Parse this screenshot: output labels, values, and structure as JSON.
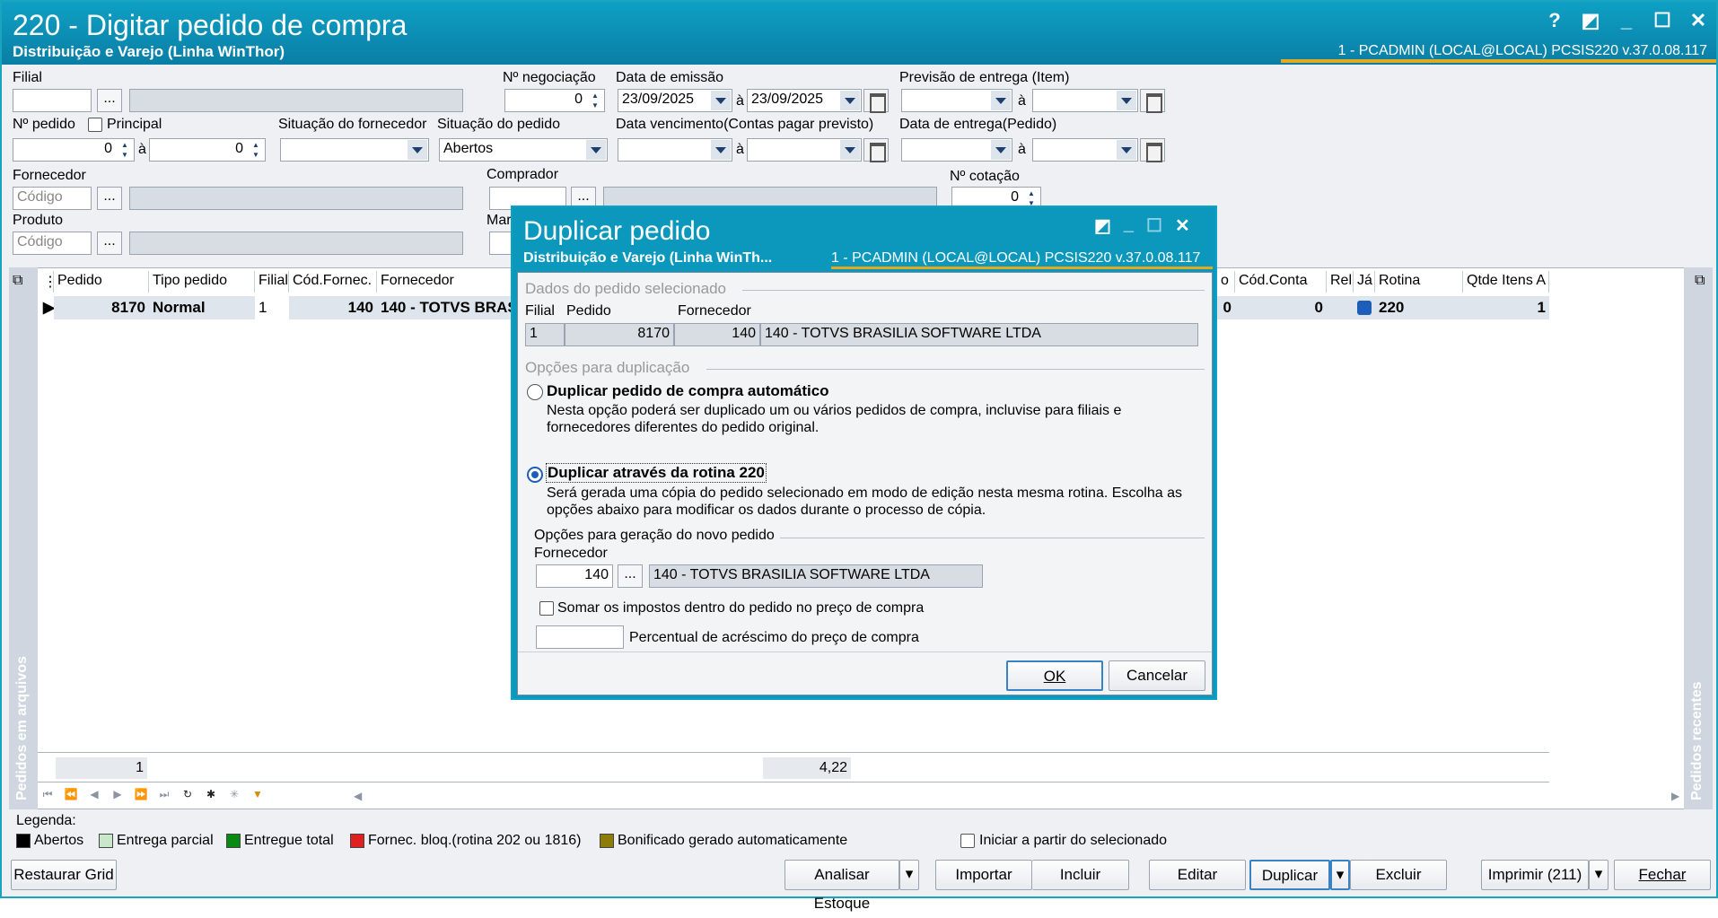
{
  "window": {
    "title": "220 - Digitar pedido de compra",
    "subtitle": "Distribuição e Varejo (Linha WinThor)",
    "status": "1 - PCADMIN (LOCAL@LOCAL)   PCSIS220  v.37.0.08.117",
    "buttons": [
      "?",
      "◩",
      "_",
      "☐",
      "✕"
    ]
  },
  "filters": {
    "filial_label": "Filial",
    "dots": "...",
    "negociacao_label": "Nº negociação",
    "negociacao_value": "0",
    "emissao_label": "Data de emissão",
    "emissao_from": "23/09/2025",
    "emissao_to": "23/09/2025",
    "a": "à",
    "previsao_label": "Previsão  de entrega (Item)",
    "pedido_label": "Nº pedido",
    "principal_label": "Principal",
    "pedido_from": "0",
    "pedido_to": "0",
    "sit_fornec_label": "Situação do fornecedor",
    "sit_pedido_label": "Situação do pedido",
    "sit_pedido_value": "Abertos",
    "vencimento_label": "Data vencimento(Contas pagar previsto)",
    "entrega_label": "Data de entrega(Pedido)",
    "fornecedor_label": "Fornecedor",
    "codigo_placeholder": "Código",
    "comprador_label": "Comprador",
    "cotacao_label": "Nº cotação",
    "cotacao_value": "0",
    "produto_label": "Produto",
    "mar_label": "Mar"
  },
  "grid": {
    "headers_left": [
      "Pedido",
      "Tipo pedido",
      "Filial",
      "Cód.Fornec.",
      "Fornecedor"
    ],
    "headers_right": [
      "o",
      "Cód.Conta",
      "Rel",
      "Já",
      "Rotina",
      "Qtde Itens A"
    ],
    "row": {
      "pedido": "8170",
      "tipo": "Normal",
      "filial": "1",
      "cod_fornec": "140",
      "fornecedor": "140 - TOTVS BRASI",
      "o": "0",
      "cod_conta": "0",
      "rotina": "220",
      "qtde": "1"
    },
    "footer_count": "1",
    "footer_total": "4,22",
    "side_left": "Pedidos em arquivos",
    "side_right": "Pedidos recentes"
  },
  "legend": {
    "label": "Legenda:",
    "items": [
      {
        "text": "Abertos",
        "color": "#000000"
      },
      {
        "text": "Entrega parcial",
        "color": "#c9e8c9"
      },
      {
        "text": "Entregue total",
        "color": "#0a8a12"
      },
      {
        "text": "Fornec. bloq.(rotina 202 ou 1816)",
        "color": "#e02020"
      },
      {
        "text": "Bonificado gerado automaticamente",
        "color": "#8c7d0a"
      }
    ],
    "iniciar": "Iniciar a partir do selecionado"
  },
  "buttons": {
    "restaurar": "Restaurar Grid",
    "analisar": "Analisar Estoque",
    "importar": "Importar",
    "incluir": "Incluir",
    "editar": "Editar",
    "duplicar": "Duplicar",
    "excluir": "Excluir",
    "imprimir": "Imprimir (211)",
    "fechar": "Fechar"
  },
  "dialog": {
    "title": "Duplicar pedido",
    "subtitle": "Distribuição e Varejo (Linha WinTh...",
    "status": "1 - PCADMIN (LOCAL@LOCAL)   PCSIS220  v.37.0.08.117",
    "sec1": "Dados do pedido selecionado",
    "col_filial": "Filial",
    "col_pedido": "Pedido",
    "col_fornecedor": "Fornecedor",
    "filial": "1",
    "pedido": "8170",
    "fornec_cod": "140",
    "fornec_nome": "140 - TOTVS BRASILIA SOFTWARE LTDA",
    "sec2": "Opções para duplicação",
    "opt1_title": "Duplicar pedido de compra automático",
    "opt1_desc1": "Nesta opção poderá ser duplicado um ou vários pedidos de compra, incluvise para filiais e",
    "opt1_desc2": "fornecedores diferentes do pedido original.",
    "opt2_title": "Duplicar através da rotina 220",
    "opt2_desc1": "Será gerada uma cópia do pedido selecionado em modo de edição nesta mesma rotina. Escolha as",
    "opt2_desc2": "opções abaixo para modificar os dados durante o processo de cópia.",
    "sec3": "Opções para geração do novo pedido",
    "fornecedor_label": "Fornecedor",
    "new_cod": "140",
    "new_nome": "140 - TOTVS BRASILIA SOFTWARE LTDA",
    "somar": "Somar os impostos dentro do pedido no preço de compra",
    "percentual": "Percentual de acréscimo do preço de compra",
    "ok": "OK",
    "cancelar": "Cancelar"
  }
}
